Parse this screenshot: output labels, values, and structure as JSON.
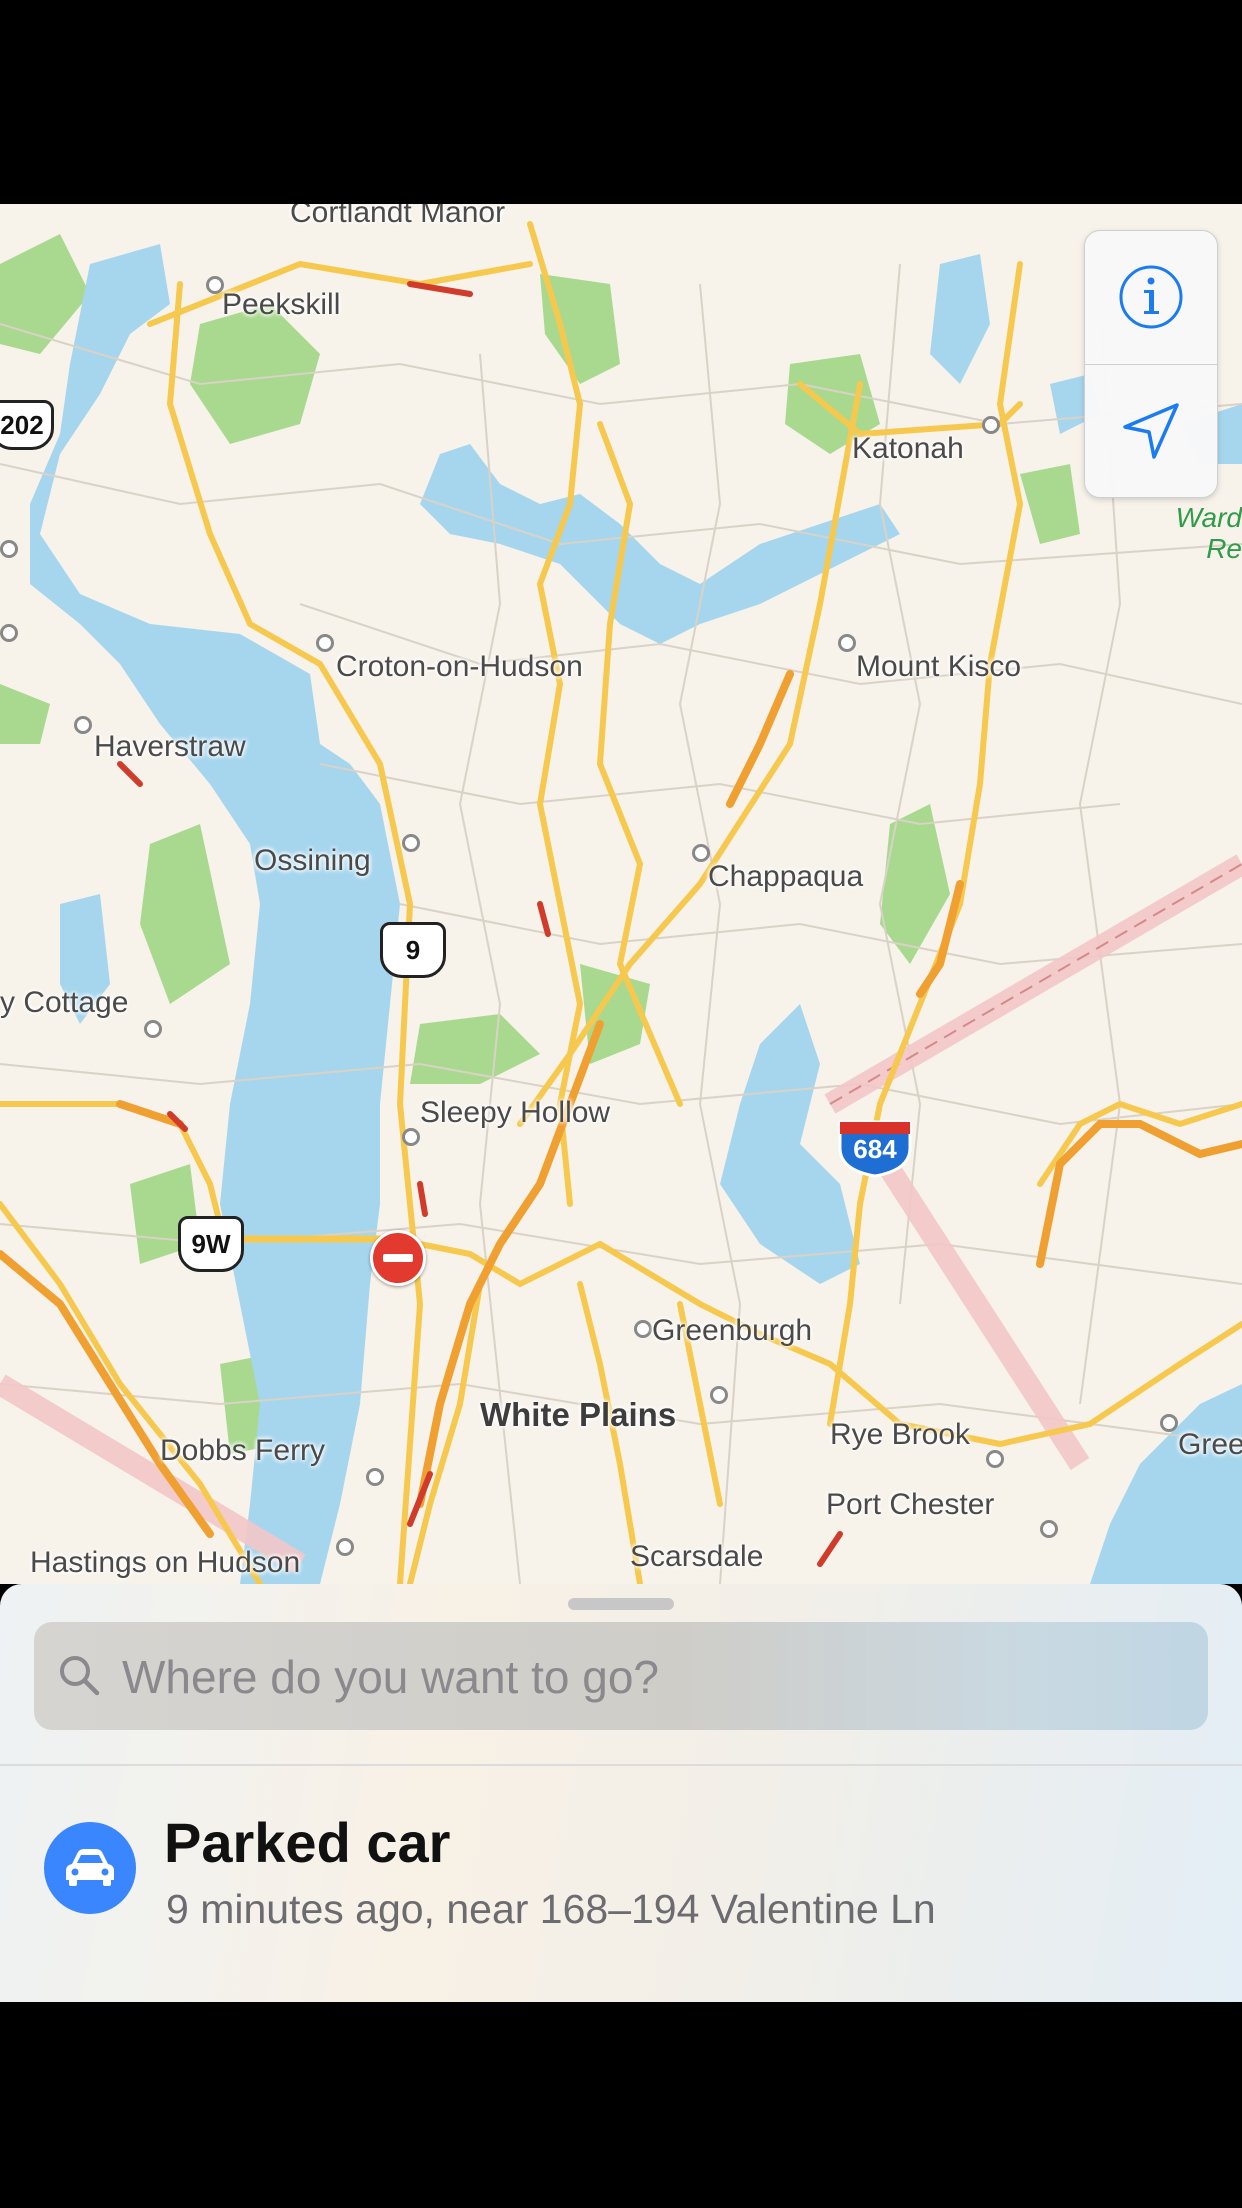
{
  "map": {
    "places": [
      {
        "name": "Cortlandt Manor",
        "style": "normal"
      },
      {
        "name": "Peekskill",
        "style": "normal"
      },
      {
        "name": "Katonah",
        "style": "normal"
      },
      {
        "name": "Croton-on-Hudson",
        "style": "normal"
      },
      {
        "name": "Mount Kisco",
        "style": "normal"
      },
      {
        "name": "Haverstraw",
        "style": "normal"
      },
      {
        "name": "Ossining",
        "style": "normal"
      },
      {
        "name": "Chappaqua",
        "style": "normal"
      },
      {
        "name": "y Cottage",
        "style": "normal"
      },
      {
        "name": "Sleepy Hollow",
        "style": "normal"
      },
      {
        "name": "Greenburgh",
        "style": "normal"
      },
      {
        "name": "White Plains",
        "style": "big"
      },
      {
        "name": "Rye Brook",
        "style": "normal"
      },
      {
        "name": "Dobbs Ferry",
        "style": "normal"
      },
      {
        "name": "Port Chester",
        "style": "normal"
      },
      {
        "name": "Hastings on Hudson",
        "style": "normal"
      },
      {
        "name": "Scarsdale",
        "style": "normal"
      },
      {
        "name": "Gree",
        "style": "normal"
      }
    ],
    "park_label_line1": "Ward",
    "park_label_line2": "Re",
    "route_shields": {
      "us_202": "202",
      "us_9": "9",
      "us_9w": "9W",
      "interstate_684": "684"
    }
  },
  "controls": {
    "info_icon": "info-icon",
    "location_icon": "location-arrow-icon",
    "accent_color": "#1a7cf0"
  },
  "search": {
    "placeholder": "Where do you want to go?",
    "value": ""
  },
  "suggestion": {
    "title": "Parked car",
    "subtitle": "9 minutes ago, near 168–194 Valentine Ln",
    "icon": "car-icon",
    "icon_color": "#3a86ff"
  }
}
